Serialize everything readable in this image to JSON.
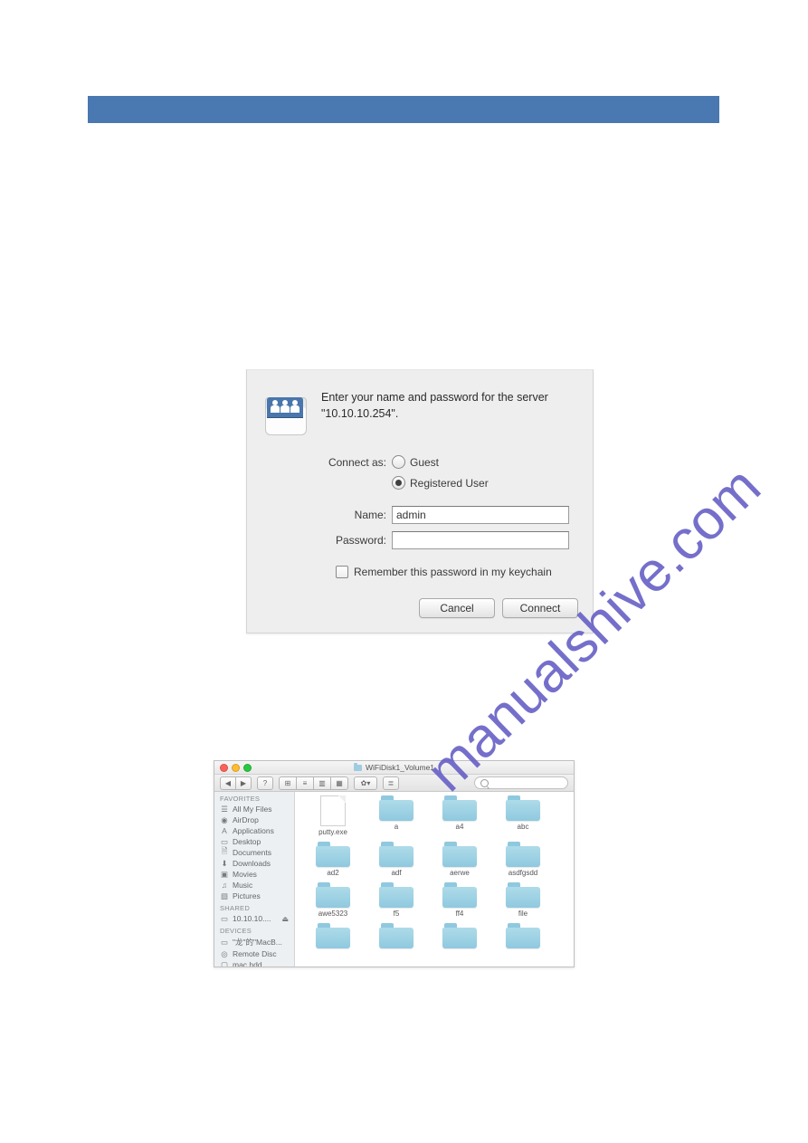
{
  "watermark": "manualshive.com",
  "dialog": {
    "message": "Enter your name and password for the server \"10.10.10.254\".",
    "connect_as_label": "Connect as:",
    "option_guest": "Guest",
    "option_registered": "Registered User",
    "name_label": "Name:",
    "name_value": "admin",
    "password_label": "Password:",
    "password_value": "",
    "remember_label": "Remember this password in my keychain",
    "cancel_label": "Cancel",
    "connect_label": "Connect"
  },
  "finder": {
    "title": "WiFiDisk1_Volume1",
    "search_placeholder": "",
    "toolbar": {
      "back": "◀",
      "forward": "▶",
      "view_icon": "⊞",
      "view_list": "≡",
      "view_col": "▥",
      "view_cover": "▦",
      "action": "✿▾",
      "arrange": "≣"
    },
    "sidebar": {
      "favorites_title": "FAVORITES",
      "favorites": [
        {
          "label": "All My Files",
          "icon": "☰"
        },
        {
          "label": "AirDrop",
          "icon": "◉"
        },
        {
          "label": "Applications",
          "icon": "A"
        },
        {
          "label": "Desktop",
          "icon": "▭"
        },
        {
          "label": "Documents",
          "icon": "🗎"
        },
        {
          "label": "Downloads",
          "icon": "⬇"
        },
        {
          "label": "Movies",
          "icon": "▣"
        },
        {
          "label": "Music",
          "icon": "♫"
        },
        {
          "label": "Pictures",
          "icon": "▧"
        }
      ],
      "shared_title": "SHARED",
      "shared": [
        {
          "label": "10.10.10....",
          "icon": "▭",
          "eject": "⏏"
        }
      ],
      "devices_title": "DEVICES",
      "devices": [
        {
          "label": "\"龙\"的\"MacB...",
          "icon": "▭"
        },
        {
          "label": "Remote Disc",
          "icon": "◎"
        },
        {
          "label": "mac hdd",
          "icon": "▢"
        }
      ]
    },
    "items": [
      {
        "name": "putty.exe",
        "type": "file"
      },
      {
        "name": "a",
        "type": "folder"
      },
      {
        "name": "a4",
        "type": "folder"
      },
      {
        "name": "abc",
        "type": "folder"
      },
      {
        "name": "ad2",
        "type": "folder"
      },
      {
        "name": "adf",
        "type": "folder"
      },
      {
        "name": "aerwe",
        "type": "folder"
      },
      {
        "name": "asdfgsdd",
        "type": "folder"
      },
      {
        "name": "awe5323",
        "type": "folder"
      },
      {
        "name": "f5",
        "type": "folder"
      },
      {
        "name": "ff4",
        "type": "folder"
      },
      {
        "name": "file",
        "type": "folder"
      },
      {
        "name": "",
        "type": "folder"
      },
      {
        "name": "",
        "type": "folder"
      },
      {
        "name": "",
        "type": "folder"
      },
      {
        "name": "",
        "type": "folder"
      }
    ]
  }
}
